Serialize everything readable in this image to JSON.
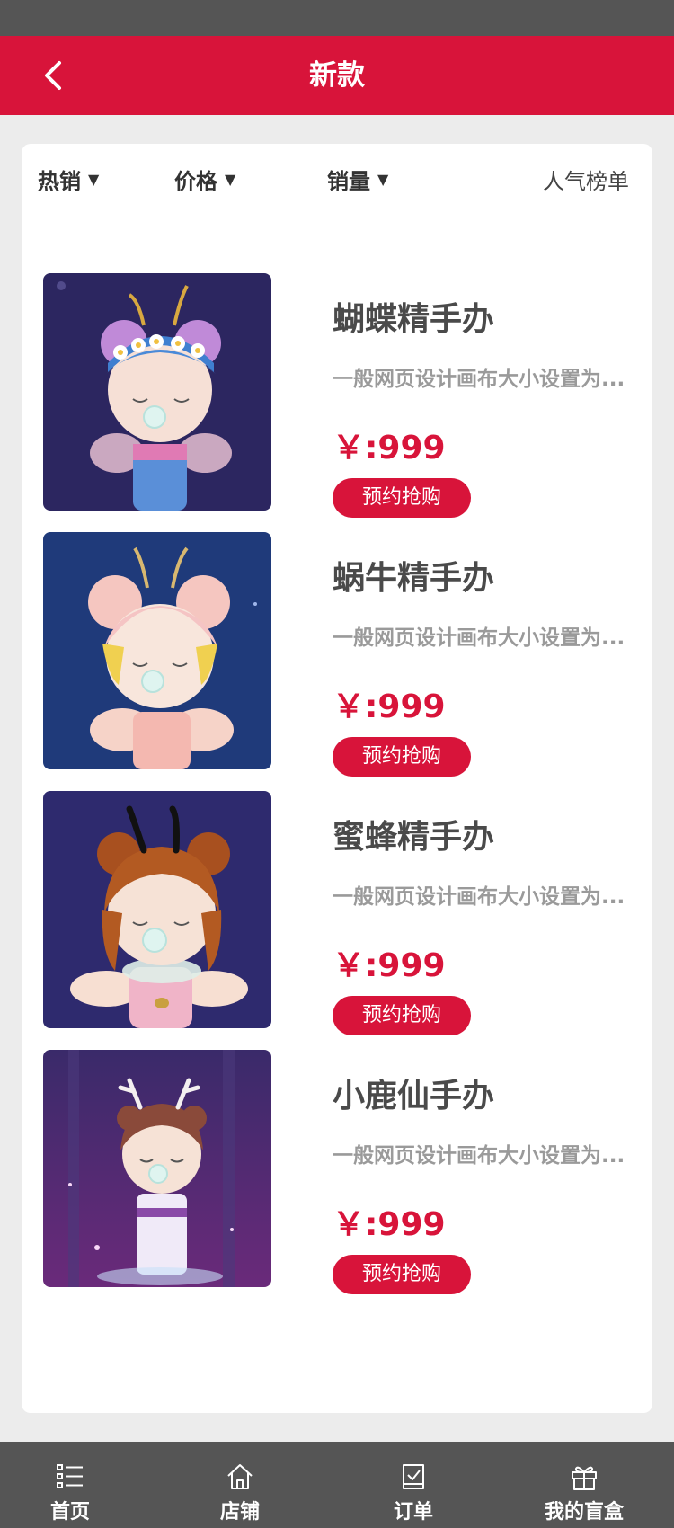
{
  "header": {
    "title": "新款"
  },
  "filters": {
    "hot": "热销",
    "price": "价格",
    "sales": "销量",
    "ranking": "人气榜单",
    "arrow": "▼"
  },
  "products": [
    {
      "name": "蝴蝶精手办",
      "desc": "一般网页设计画布大小设置为...",
      "price": "￥:999",
      "button": "预约抢购",
      "image": "butterfly-figure"
    },
    {
      "name": "蜗牛精手办",
      "desc": "一般网页设计画布大小设置为...",
      "price": "￥:999",
      "button": "预约抢购",
      "image": "snail-figure"
    },
    {
      "name": "蜜蜂精手办",
      "desc": "一般网页设计画布大小设置为...",
      "price": "￥:999",
      "button": "预约抢购",
      "image": "bee-figure"
    },
    {
      "name": "小鹿仙手办",
      "desc": "一般网页设计画布大小设置为...",
      "price": "￥:999",
      "button": "预约抢购",
      "image": "deer-figure"
    }
  ],
  "tabbar": {
    "items": [
      {
        "label": "首页",
        "icon": "list-icon"
      },
      {
        "label": "店铺",
        "icon": "home-icon"
      },
      {
        "label": "订单",
        "icon": "order-check-icon"
      },
      {
        "label": "我的盲盒",
        "icon": "gift-box-icon"
      }
    ]
  },
  "colors": {
    "accent": "#d8143a",
    "bar": "#555555",
    "background": "#ececec"
  }
}
